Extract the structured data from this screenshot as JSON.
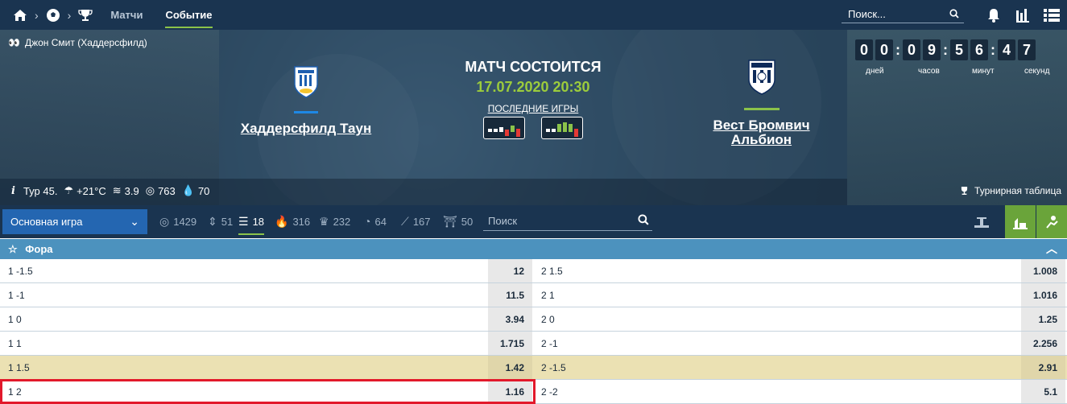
{
  "nav": {
    "home_icon": "home-icon",
    "sport_icon": "soccer-ball-icon",
    "trophy_icon": "trophy-icon",
    "tabs": [
      {
        "label": "Матчи"
      },
      {
        "label": "Событие"
      }
    ],
    "search_placeholder": "Поиск...",
    "right_icons": [
      "bell-icon",
      "stats-icon",
      "list-icon"
    ]
  },
  "event": {
    "player": "Джон Смит (Хаддерсфилд)",
    "home_team": "Хаддерсфилд Таун",
    "away_team": "Вест Бромвич Альбион",
    "status": "МАТЧ СОСТОИТСЯ",
    "datetime": "17.07.2020 20:30",
    "last_games_label": "ПОСЛЕДНИЕ ИГРЫ",
    "home_color": "#1e88e5",
    "away_color": "#8bc34a",
    "timer": {
      "digits": [
        "0",
        "0",
        "0",
        "9",
        "5",
        "6",
        "4",
        "7"
      ],
      "labels": [
        "дней",
        "часов",
        "минут",
        "секунд"
      ]
    },
    "weather": {
      "round": "Тур 45.",
      "temp": "+21°C",
      "wind": "3.9",
      "pressure": "763",
      "humidity": "70"
    },
    "standings_label": "Турнирная таблица"
  },
  "filters": {
    "select_value": "Основная игра",
    "tabs": [
      {
        "icon": "target-icon",
        "count": "1429"
      },
      {
        "icon": "updown-icon",
        "count": "51"
      },
      {
        "icon": "bars-icon",
        "count": "18"
      },
      {
        "icon": "fire-icon",
        "count": "316"
      },
      {
        "icon": "trophy-icon",
        "count": "232"
      },
      {
        "icon": "timer-icon",
        "count": "64"
      },
      {
        "icon": "whistle-icon",
        "count": "167"
      },
      {
        "icon": "gate-icon",
        "count": "50"
      }
    ],
    "search_placeholder": "Поиск"
  },
  "market": {
    "title": "Фора",
    "rows": [
      {
        "left_label": "1 -1.5",
        "left_odd": "12",
        "right_label": "2 1.5",
        "right_odd": "1.008",
        "highlight": false
      },
      {
        "left_label": "1 -1",
        "left_odd": "11.5",
        "right_label": "2 1",
        "right_odd": "1.016",
        "highlight": false
      },
      {
        "left_label": "1 0",
        "left_odd": "3.94",
        "right_label": "2 0",
        "right_odd": "1.25",
        "highlight": false
      },
      {
        "left_label": "1 1",
        "left_odd": "1.715",
        "right_label": "2 -1",
        "right_odd": "2.256",
        "highlight": false
      },
      {
        "left_label": "1 1.5",
        "left_odd": "1.42",
        "right_label": "2 -1.5",
        "right_odd": "2.91",
        "highlight": true
      },
      {
        "left_label": "1 2",
        "left_odd": "1.16",
        "right_label": "2 -2",
        "right_odd": "5.1",
        "highlight": false
      }
    ]
  }
}
